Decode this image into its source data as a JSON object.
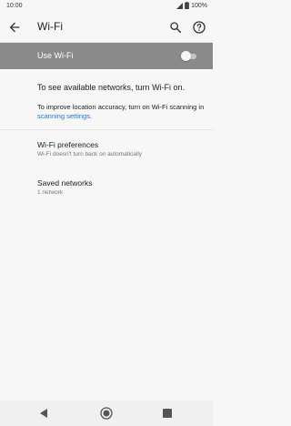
{
  "status_bar": {
    "time": "10:00",
    "battery": "100%",
    "icons": [
      "signal-icon",
      "battery-icon"
    ]
  },
  "app_bar": {
    "title": "Wi-Fi",
    "icons": [
      "back-arrow-icon",
      "search-icon",
      "help-icon"
    ]
  },
  "wifi_toggle": {
    "label": "Use Wi-Fi",
    "enabled": false
  },
  "message": {
    "turn_on": "To see available networks, turn Wi-Fi on.",
    "improve_prefix": "To improve location accuracy, turn on Wi-Fi scanning in ",
    "link_text": "scanning settings",
    "suffix": "."
  },
  "items": [
    {
      "title": "Wi-Fi preferences",
      "subtitle": "Wi-Fi doesn't turn back on automatically"
    },
    {
      "title": "Saved networks",
      "subtitle": "1 network"
    }
  ],
  "nav_bar": {
    "icons": [
      "nav-back-icon",
      "nav-home-icon",
      "nav-recents-icon"
    ]
  },
  "colors": {
    "accent_link": "#1a73e8",
    "toggle_bar_bg": "#8a8a8a",
    "background": "#f7f7f7"
  }
}
